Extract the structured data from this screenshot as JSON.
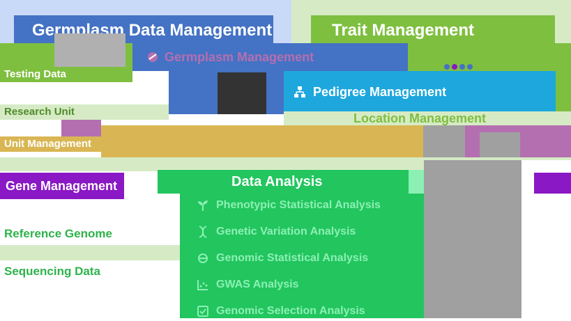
{
  "colors": {
    "germplasm_blue": "#4472c4",
    "trait_green": "#7fbf40",
    "pedigree_cyan": "#1ea7dc",
    "gold": "#d9b653",
    "data_green": "#22c55e",
    "purple": "#8a18c4",
    "light_green": "#8cf0b4",
    "grey": "#a0a0a0",
    "pale_blue": "#c9daf8",
    "pale_green": "#d6ebc5",
    "pink_purple": "#b46fb0"
  },
  "cards": {
    "germplasm_data": {
      "title": "Germplasm Data Management"
    },
    "trait": {
      "title": "Trait Management"
    },
    "germplasm_mgmt": {
      "label": "Germplasm Management"
    },
    "pedigree": {
      "label": "Pedigree Management"
    },
    "location": {
      "label": "Location Management"
    },
    "left_labels": [
      "Testing Data",
      "Research Unit",
      "Unit Management"
    ],
    "gene_mgmt": {
      "title": "Gene Management"
    },
    "data_analysis": {
      "title": "Data Analysis",
      "items": [
        {
          "label": "Phenotypic Statistical Analysis",
          "icon": "seedling-icon"
        },
        {
          "label": "Genetic Variation Analysis",
          "icon": "dna-icon"
        },
        {
          "label": "Genomic Statistical Analysis",
          "icon": "genome-icon"
        },
        {
          "label": "GWAS Analysis",
          "icon": "gwas-icon"
        },
        {
          "label": "Genomic Selection Analysis",
          "icon": "selection-icon"
        }
      ]
    },
    "reference_genome": {
      "label": "Reference Genome"
    },
    "sequencing_data": {
      "label": "Sequencing Data"
    }
  }
}
